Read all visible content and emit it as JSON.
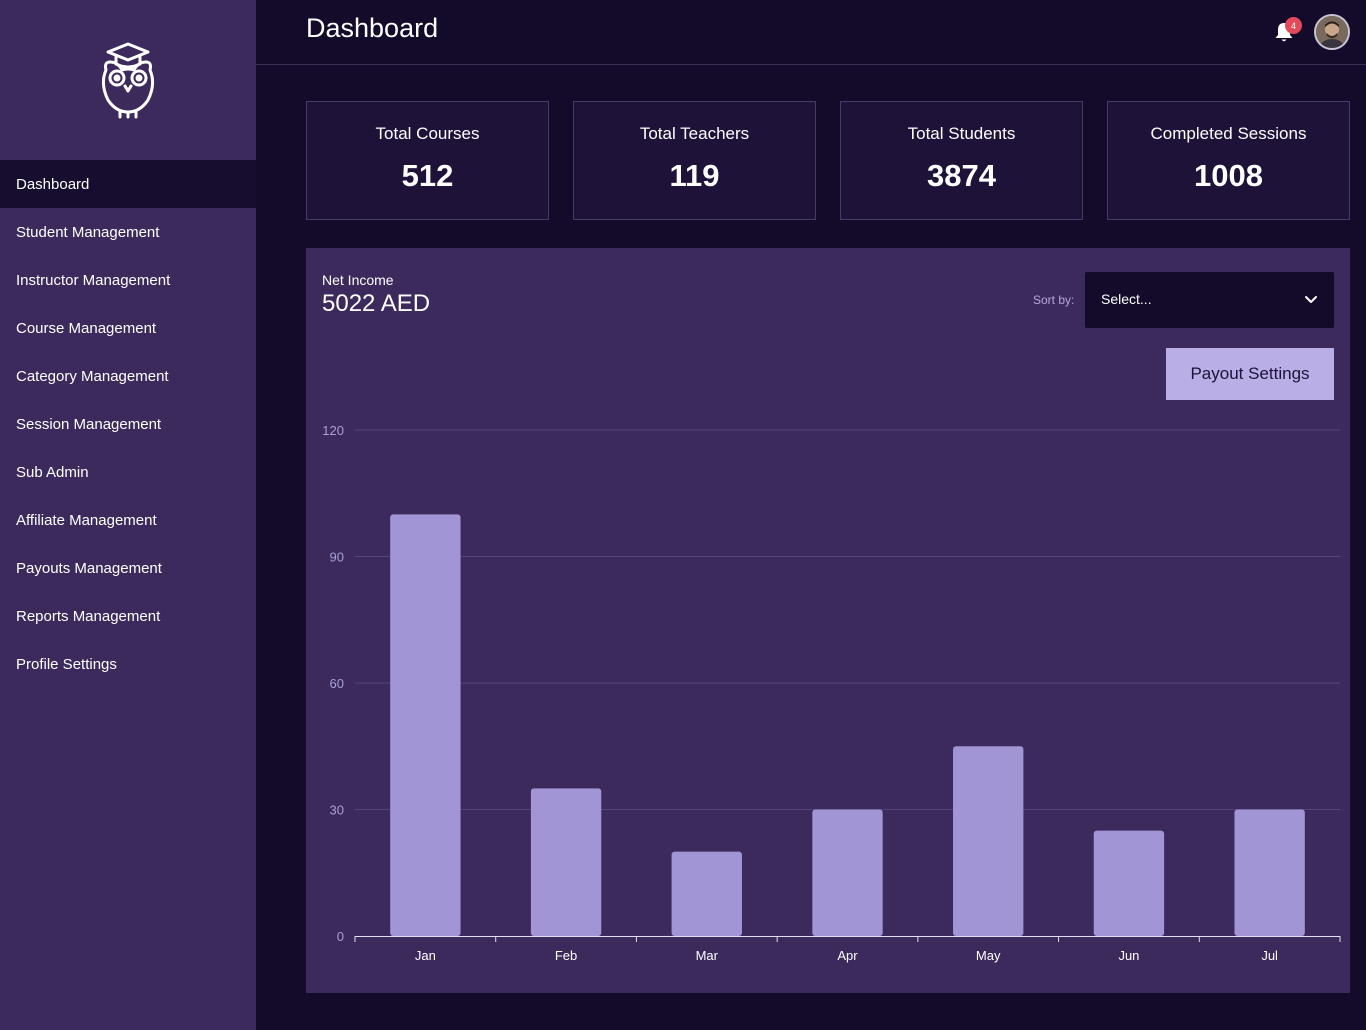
{
  "header": {
    "title": "Dashboard",
    "notification_count": "4"
  },
  "sidebar": {
    "items": [
      {
        "label": "Dashboard",
        "active": true
      },
      {
        "label": "Student Management"
      },
      {
        "label": "Instructor Management"
      },
      {
        "label": "Course Management"
      },
      {
        "label": "Category Management"
      },
      {
        "label": "Session Management"
      },
      {
        "label": "Sub Admin"
      },
      {
        "label": "Affiliate Management"
      },
      {
        "label": "Payouts Management"
      },
      {
        "label": "Reports Management"
      },
      {
        "label": "Profile Settings"
      }
    ]
  },
  "stats": [
    {
      "label": "Total Courses",
      "value": "512"
    },
    {
      "label": "Total Teachers",
      "value": "119"
    },
    {
      "label": "Total Students",
      "value": "3874"
    },
    {
      "label": "Completed Sessions",
      "value": "1008"
    }
  ],
  "income": {
    "label": "Net Income",
    "value": "5022 AED",
    "sort_label": "Sort by:",
    "select_value": "Select...",
    "payout_button": "Payout Settings"
  },
  "colors": {
    "bar": "#a195d6",
    "panel": "#3c2a5c",
    "grid": "#54457a",
    "tick_text": "#a99fd6",
    "axis": "#e4e0f0"
  },
  "chart_data": {
    "type": "bar",
    "categories": [
      "Jan",
      "Feb",
      "Mar",
      "Apr",
      "May",
      "Jun",
      "Jul"
    ],
    "values": [
      100,
      35,
      20,
      30,
      45,
      25,
      30
    ],
    "yticks": [
      0,
      30,
      60,
      90,
      120
    ],
    "ylim": [
      0,
      120
    ],
    "grid": true,
    "title": "",
    "xlabel": "",
    "ylabel": ""
  }
}
